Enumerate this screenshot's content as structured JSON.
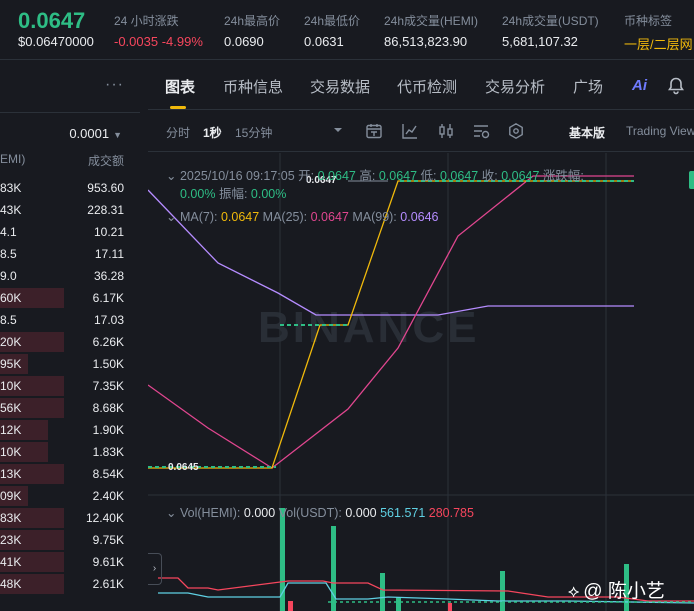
{
  "ticker": {
    "last_price": "0.0647",
    "last_usd": "$0.06470000",
    "change_label": "24 小时涨跌",
    "change_value": "-0.0035 -4.99%",
    "high_label": "24h最高价",
    "high_value": "0.0690",
    "low_label": "24h最低价",
    "low_value": "0.0631",
    "vol_base_label": "24h成交量(HEMI)",
    "vol_base_value": "86,513,823.90",
    "vol_quote_label": "24h成交量(USDT)",
    "vol_quote_value": "5,681,107.32",
    "tag_label": "币种标签",
    "tag_value": "一层/二层网"
  },
  "orderbook": {
    "menu_icon": "more-dots-icon",
    "step_value": "0.0001",
    "col_amount_header": "EMI)",
    "col_total_header": "成交额",
    "rows": [
      {
        "amount": "83K",
        "total": "953.60",
        "depth": 0
      },
      {
        "amount": "43K",
        "total": "228.31",
        "depth": 0
      },
      {
        "amount": "4.1",
        "total": "10.21",
        "depth": 0
      },
      {
        "amount": "8.5",
        "total": "17.11",
        "depth": 0
      },
      {
        "amount": "9.0",
        "total": "36.28",
        "depth": 0
      },
      {
        "amount": "60K",
        "total": "6.17K",
        "depth": 0.46
      },
      {
        "amount": "8.5",
        "total": "17.03",
        "depth": 0
      },
      {
        "amount": "20K",
        "total": "6.26K",
        "depth": 0.46
      },
      {
        "amount": "95K",
        "total": "1.50K",
        "depth": 0.2
      },
      {
        "amount": "10K",
        "total": "7.35K",
        "depth": 0.46
      },
      {
        "amount": "56K",
        "total": "8.68K",
        "depth": 0.46
      },
      {
        "amount": "12K",
        "total": "1.90K",
        "depth": 0.34
      },
      {
        "amount": "10K",
        "total": "1.83K",
        "depth": 0.34
      },
      {
        "amount": "13K",
        "total": "8.54K",
        "depth": 0.46
      },
      {
        "amount": "09K",
        "total": "2.40K",
        "depth": 0.2
      },
      {
        "amount": "83K",
        "total": "12.40K",
        "depth": 0.46
      },
      {
        "amount": "23K",
        "total": "9.75K",
        "depth": 0.46
      },
      {
        "amount": "41K",
        "total": "9.61K",
        "depth": 0.46
      },
      {
        "amount": "48K",
        "total": "2.61K",
        "depth": 0.46
      }
    ]
  },
  "tabs": [
    {
      "label": "图表",
      "active": true
    },
    {
      "label": "币种信息",
      "active": false
    },
    {
      "label": "交易数据",
      "active": false
    },
    {
      "label": "代币检测",
      "active": false
    },
    {
      "label": "交易分析",
      "active": false
    },
    {
      "label": "广场",
      "active": false
    }
  ],
  "ai_label": "Ai",
  "toolbar": {
    "interval_time": "分时",
    "interval_1s": "1秒",
    "interval_15m": "15分钟",
    "basic_view": "基本版",
    "tradingview": "Trading View"
  },
  "candle_info": {
    "datetime": "2025/10/16 09:17:05",
    "open_label": "开:",
    "open": "0.0647",
    "high_label": "高:",
    "high": "0.0647",
    "low_label": "低:",
    "low": "0.0647",
    "close_label": "收:",
    "close": "0.0647",
    "change_label": "涨跌幅:",
    "change": "0.00%",
    "amplitude_label": "振幅:",
    "amplitude": "0.00%"
  },
  "ma_info": {
    "ma7_label": "MA(7):",
    "ma7": "0.0647",
    "ma25_label": "MA(25):",
    "ma25": "0.0647",
    "ma99_label": "MA(99):",
    "ma99": "0.0646"
  },
  "price_tags": {
    "top": "0.0647",
    "bottom": "0.0645"
  },
  "watermark_text": "BINANCE",
  "vol_info": {
    "vol_hemi_label": "Vol(HEMI):",
    "vol_hemi": "0.000",
    "vol_usdt_label": "Vol(USDT):",
    "vol_usdt": "0.000",
    "ma1": "561.571",
    "ma2": "280.785"
  },
  "author_watermark": "@ 陈小艺",
  "colors": {
    "up": "#2ebd85",
    "down": "#f6465d",
    "ma7": "#f0b90b",
    "ma25": "#e0468f",
    "ma99": "#b58cff"
  }
}
